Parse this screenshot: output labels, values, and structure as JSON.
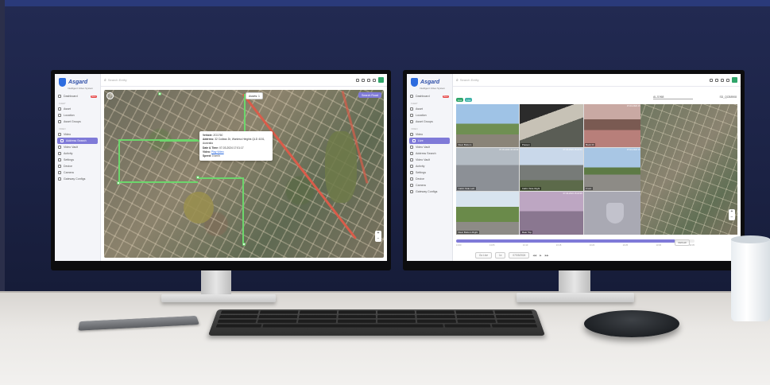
{
  "left_screen": {
    "logo": {
      "name": "Asgard",
      "subtitle": "Intelligent Video System"
    },
    "search_placeholder": "Search Entity",
    "sidebar": {
      "dashboard": "Dashboard",
      "dashboard_badge": "New",
      "section_fleet": "FLEET",
      "fleet_items": [
        "Asset",
        "Location",
        "Asset Groups"
      ],
      "section_video": "VIDEO",
      "video_items": [
        "Video",
        "Address Search",
        "Video Vault",
        "Activity",
        "Settings",
        "Device",
        "Camera",
        "Gateway Configs"
      ],
      "active_item": "Address Search"
    },
    "map": {
      "selector": "Assets: 1",
      "search_button": "Search Road",
      "popup": {
        "vehicle_label": "Vehicle:",
        "vehicle_value": "ZG1760",
        "address_label": "Address:",
        "address_value": "32 Cutlass Dr, Wanless Heights QLD 4151, Australia",
        "datetime_label": "Date & Time:",
        "datetime_value": "07-03-2024 17:01:17",
        "video_label": "Video:",
        "video_value": "Play Video",
        "speed_label": "Speed:",
        "speed_value": "0 km/h"
      }
    }
  },
  "right_screen": {
    "logo": {
      "name": "Asgard",
      "subtitle": "Intelligent Video System"
    },
    "search_placeholder": "Search Entity",
    "sidebar": {
      "dashboard": "Dashboard",
      "dashboard_badge": "New",
      "section_fleet": "FLEET",
      "fleet_items": [
        "Asset",
        "Location",
        "Asset Groups"
      ],
      "section_video": "VIDEO",
      "video_items": [
        "Video",
        "Live",
        "Video Vault",
        "Address Search",
        "Video Vault",
        "Activity",
        "Settings",
        "Device",
        "Camera",
        "Gateway Configs"
      ],
      "active_item": "Live"
    },
    "tags": [
      "Live",
      "Live"
    ],
    "vehicle_select": "ALJ1968",
    "sd_select": "SD_QCB8908",
    "cameras": [
      {
        "label": "Rear Bottom",
        "time": ""
      },
      {
        "label": "Passen",
        "time": ""
      },
      {
        "label": "Back Ri",
        "time": "07-03-2024  15:18:08"
      },
      {
        "label": "Cabin Side Left",
        "time": "07-03-2024  15:18:09"
      },
      {
        "label": "Cabin Side Right",
        "time": "07-03-2024  15:18:01"
      },
      {
        "label": "Front",
        "time": "07-03-2024  15:18:09"
      },
      {
        "label": "Rear Bottom Right",
        "time": ""
      },
      {
        "label": "Rear Top",
        "time": "07-03-2024  15:18:09"
      },
      {
        "label": "",
        "time": ""
      }
    ],
    "timeline_ticks": [
      "13:00",
      "13:05",
      "13:10",
      "13:15",
      "13:20",
      "13:25",
      "13:30",
      "13:35"
    ],
    "controls": {
      "date": "07/03/2024",
      "speed": "1x",
      "go_label": "Go Live",
      "refresh": "Refresh"
    }
  },
  "colors": {
    "accent": "#7f7ad8",
    "route": "#6cd66c",
    "badge": "#e64646",
    "live": "#2fa56a"
  }
}
